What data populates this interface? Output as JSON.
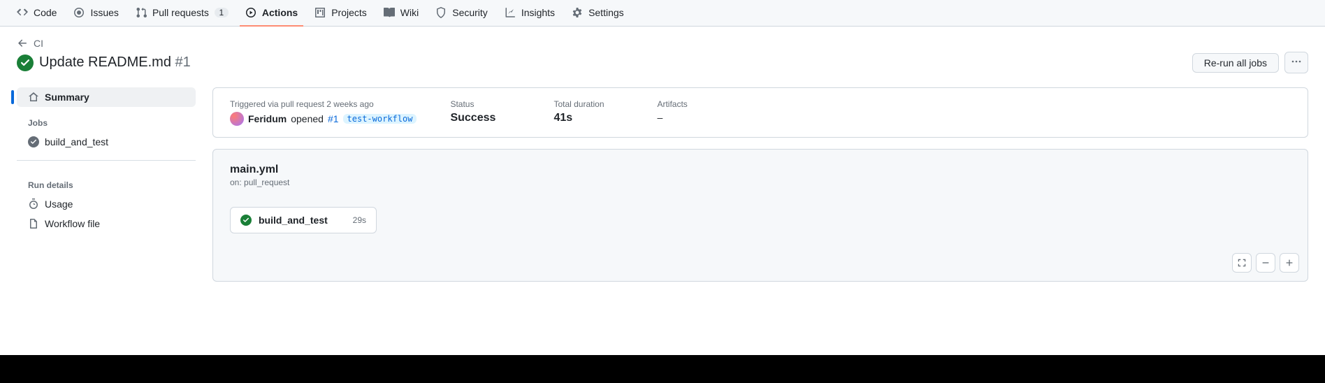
{
  "repoNav": {
    "code": "Code",
    "issues": "Issues",
    "pull_requests": "Pull requests",
    "pull_requests_count": "1",
    "actions": "Actions",
    "projects": "Projects",
    "wiki": "Wiki",
    "security": "Security",
    "insights": "Insights",
    "settings": "Settings"
  },
  "breadcrumb": {
    "back_label": "CI"
  },
  "run": {
    "title": "Update README.md",
    "number": "#1"
  },
  "actions": {
    "rerun": "Re-run all jobs"
  },
  "sidebar": {
    "summary": "Summary",
    "jobs_title": "Jobs",
    "jobs": [
      {
        "name": "build_and_test"
      }
    ],
    "run_details_title": "Run details",
    "usage": "Usage",
    "workflow_file": "Workflow file"
  },
  "summary": {
    "triggered_label": "Triggered via pull request 2 weeks ago",
    "actor": "Feridum",
    "opened_text": "opened",
    "pr_ref": "#1",
    "branch": "test-workflow",
    "status_label": "Status",
    "status_value": "Success",
    "duration_label": "Total duration",
    "duration_value": "41s",
    "artifacts_label": "Artifacts",
    "artifacts_value": "–"
  },
  "graph": {
    "file": "main.yml",
    "trigger": "on: pull_request",
    "job_name": "build_and_test",
    "job_duration": "29s"
  }
}
